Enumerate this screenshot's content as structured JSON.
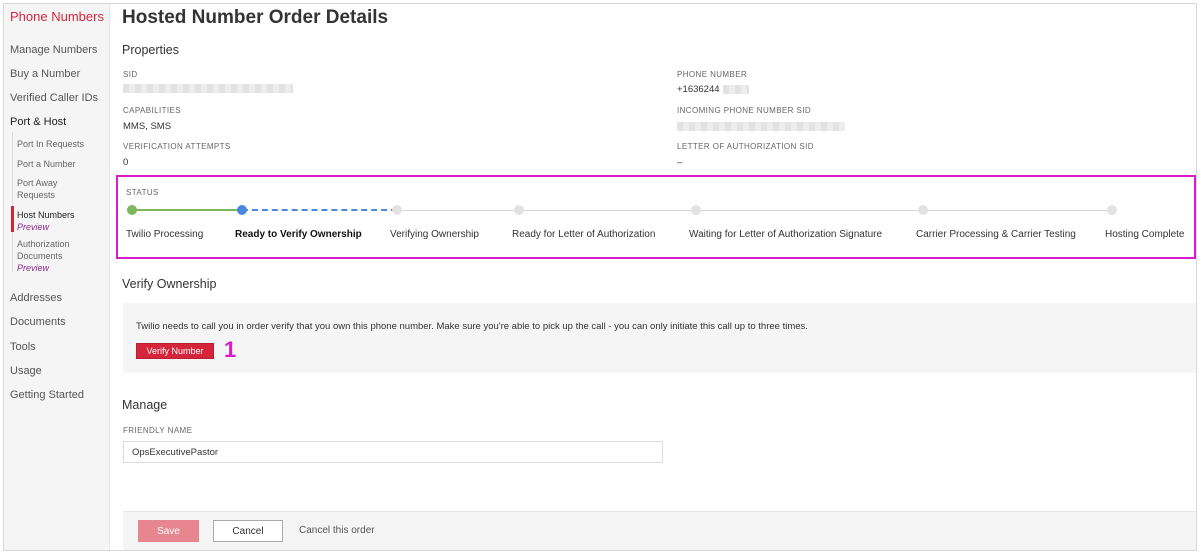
{
  "sidebar": {
    "title": "Phone Numbers",
    "items": [
      {
        "label": "Manage Numbers"
      },
      {
        "label": "Buy a Number"
      },
      {
        "label": "Verified Caller IDs"
      },
      {
        "label": "Port & Host"
      },
      {
        "label": "Addresses"
      },
      {
        "label": "Documents"
      },
      {
        "label": "Tools"
      },
      {
        "label": "Usage"
      },
      {
        "label": "Getting Started"
      }
    ],
    "sub_items": [
      {
        "label": "Port In Requests"
      },
      {
        "label": "Port a Number"
      },
      {
        "label": "Port Away Requests"
      },
      {
        "label": "Host Numbers",
        "badge": "Preview"
      },
      {
        "label": "Authorization Documents",
        "badge": "Preview"
      }
    ]
  },
  "page": {
    "title": "Hosted Number Order Details"
  },
  "properties": {
    "title": "Properties",
    "sid_label": "SID",
    "phone_number_label": "PHONE NUMBER",
    "phone_number_value": "+1636244",
    "capabilities_label": "CAPABILITIES",
    "capabilities_value": "MMS, SMS",
    "incoming_sid_label": "INCOMING PHONE NUMBER SID",
    "verification_attempts_label": "VERIFICATION ATTEMPTS",
    "verification_attempts_value": "0",
    "loa_sid_label": "LETTER OF AUTHORIZATION SID",
    "loa_sid_value": "–"
  },
  "status": {
    "label": "STATUS",
    "steps": [
      {
        "label": "Twilio Processing",
        "state": "done"
      },
      {
        "label": "Ready to Verify Ownership",
        "state": "current"
      },
      {
        "label": "Verifying Ownership",
        "state": "pending"
      },
      {
        "label": "Ready for Letter of Authorization",
        "state": "pending"
      },
      {
        "label": "Waiting for Letter of Authorization Signature",
        "state": "pending"
      },
      {
        "label": "Carrier Processing & Carrier Testing",
        "state": "pending"
      },
      {
        "label": "Hosting Complete",
        "state": "pending"
      }
    ]
  },
  "verify": {
    "title": "Verify Ownership",
    "text": "Twilio needs to call you in order verify that you own this phone number. Make sure you're able to pick up the call - you can only initiate this call up to three times.",
    "button_label": "Verify Number",
    "annotation": "1"
  },
  "manage": {
    "title": "Manage",
    "friendly_name_label": "FRIENDLY NAME",
    "friendly_name_value": "OpsExecutivePastor"
  },
  "footer": {
    "save_label": "Save",
    "cancel_label": "Cancel",
    "cancel_order_label": "Cancel this order"
  },
  "colors": {
    "brand_red": "#d4253a",
    "highlight_magenta": "#d91bc9",
    "step_done": "#7cb85a",
    "step_current": "#4a88e0"
  }
}
